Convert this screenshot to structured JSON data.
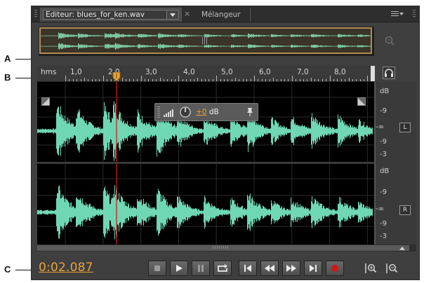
{
  "callouts": [
    "A",
    "B",
    "C"
  ],
  "tabs": {
    "editor_label": "Editeur: blues_for_ken.wav",
    "editor_close": "×",
    "mixer_label": "Mélangeur"
  },
  "ruler": {
    "unit": "hms",
    "marks": [
      "1,0",
      "2,0",
      "3,0",
      "4,0",
      "5,0",
      "6,0",
      "7,0",
      "8,0"
    ]
  },
  "hud": {
    "value": "+0",
    "unit": "dB"
  },
  "scale": {
    "top": {
      "unit": "dB",
      "upper": "-9",
      "center": "-∞",
      "lower1": "-9",
      "lower2": "-3",
      "channel": "L"
    },
    "bottom": {
      "unit": "dB",
      "upper": "-9",
      "center": "-∞",
      "lower1": "-9",
      "lower2": "-3",
      "channel": "R"
    }
  },
  "transport": {
    "time": "0:02.087",
    "buttons": [
      "stop",
      "play",
      "pause",
      "loop",
      "go-to-start",
      "rewind",
      "fast-forward",
      "go-to-end",
      "record"
    ]
  },
  "colors": {
    "waveform": "#6fd7b4",
    "playhead": "#d11a1a",
    "accent": "#e8a43a",
    "record": "#d01818"
  }
}
